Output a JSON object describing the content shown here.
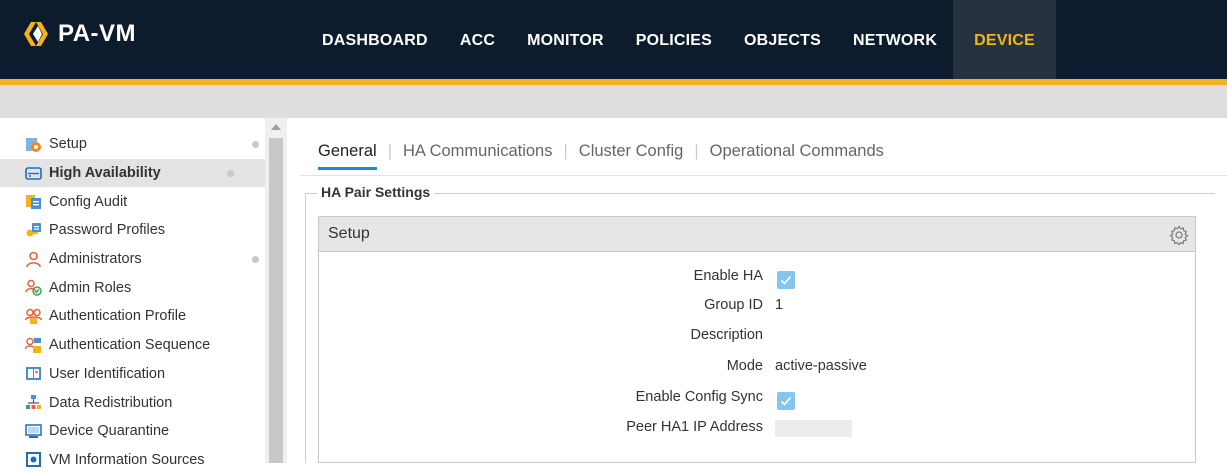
{
  "app": {
    "logo_text": "PA-VM",
    "brand_color": "#f3b41b"
  },
  "nav": {
    "tabs": [
      {
        "label": "DASHBOARD"
      },
      {
        "label": "ACC"
      },
      {
        "label": "MONITOR"
      },
      {
        "label": "POLICIES"
      },
      {
        "label": "OBJECTS"
      },
      {
        "label": "NETWORK"
      },
      {
        "label": "DEVICE",
        "active": true
      }
    ]
  },
  "sidebar": {
    "items": [
      {
        "label": "Setup",
        "icon": "setup-icon"
      },
      {
        "label": "High Availability",
        "icon": "high-availability-icon",
        "active": true
      },
      {
        "label": "Config Audit",
        "icon": "config-audit-icon"
      },
      {
        "label": "Password Profiles",
        "icon": "password-profiles-icon"
      },
      {
        "label": "Administrators",
        "icon": "administrators-icon"
      },
      {
        "label": "Admin Roles",
        "icon": "admin-roles-icon"
      },
      {
        "label": "Authentication Profile",
        "icon": "authentication-profile-icon"
      },
      {
        "label": "Authentication Sequence",
        "icon": "authentication-sequence-icon"
      },
      {
        "label": "User Identification",
        "icon": "user-identification-icon"
      },
      {
        "label": "Data Redistribution",
        "icon": "data-redistribution-icon"
      },
      {
        "label": "Device Quarantine",
        "icon": "device-quarantine-icon"
      },
      {
        "label": "VM Information Sources",
        "icon": "vm-information-sources-icon"
      }
    ]
  },
  "content": {
    "tabs": [
      {
        "label": "General",
        "active": true
      },
      {
        "label": "HA Communications"
      },
      {
        "label": "Cluster Config"
      },
      {
        "label": "Operational Commands"
      }
    ],
    "section_title": "HA Pair Settings",
    "panel_title": "Setup",
    "fields": {
      "enable_ha": {
        "label": "Enable HA",
        "checked": true
      },
      "group_id": {
        "label": "Group ID",
        "value": "1"
      },
      "description": {
        "label": "Description",
        "value": ""
      },
      "mode": {
        "label": "Mode",
        "value": "active-passive"
      },
      "enable_config_sync": {
        "label": "Enable Config Sync",
        "checked": true
      },
      "peer_ha1_ip": {
        "label": "Peer HA1 IP Address"
      }
    }
  }
}
